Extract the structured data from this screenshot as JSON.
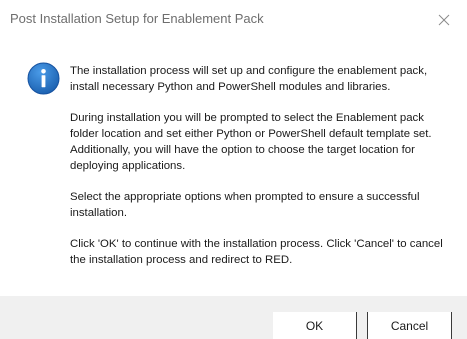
{
  "window": {
    "title": "Post Installation Setup for Enablement Pack"
  },
  "icons": {
    "info": "info-icon",
    "close": "close-icon"
  },
  "colors": {
    "info_blue": "#1f6fc5",
    "footer_bg": "#f0f0f0",
    "title_text": "#6e6e6e"
  },
  "message": {
    "paragraphs": [
      "The installation process will set up and configure the enablement pack, install necessary Python and PowerShell modules and libraries.",
      "During installation you will be prompted to select the Enablement pack folder location and set either Python or PowerShell default template set. Additionally, you will have the option to choose the target location for deploying applications.",
      "Select the appropriate options when prompted to ensure a successful installation.",
      "Click 'OK' to continue with the installation process. Click 'Cancel' to cancel the installation process and redirect to RED."
    ]
  },
  "buttons": {
    "ok_label": "OK",
    "cancel_label": "Cancel"
  }
}
